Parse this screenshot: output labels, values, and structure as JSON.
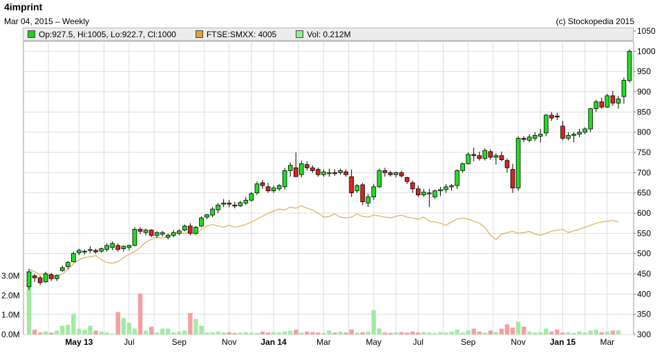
{
  "header": {
    "title": "4imprint",
    "subtitle": "Mar 04, 2015 – Weekly",
    "copyright": "(c) Stockopedia 2015"
  },
  "legend": [
    {
      "label": "Op:927.5, Hi:1005, Lo:922.7, Cl:1000",
      "color": "#22cc22"
    },
    {
      "label": "FTSE:SMXX: 4005",
      "color": "#e0a040"
    },
    {
      "label": "Vol: 0.212M",
      "color": "#90ee90"
    }
  ],
  "chart_data": {
    "type": "candlestick",
    "colors": {
      "up": "#22dd22",
      "down": "#dd2222",
      "index_line": "#e5b060",
      "vol_up": "#a4eaa4",
      "vol_down": "#f4a0a0",
      "grid": "#dddddd"
    },
    "price_axis": {
      "min": 300,
      "max": 1050,
      "ticks": [
        300,
        350,
        400,
        450,
        500,
        550,
        600,
        650,
        700,
        750,
        800,
        850,
        900,
        950,
        1000,
        1050
      ]
    },
    "volume_axis": {
      "min": 0,
      "max": 3.0,
      "ticks": [
        {
          "v": 0,
          "label": "0.0M"
        },
        {
          "v": 1,
          "label": "1.0M"
        },
        {
          "v": 2,
          "label": "2.0M"
        },
        {
          "v": 3,
          "label": "3.0M"
        }
      ]
    },
    "x_ticks": [
      {
        "i": 9,
        "label": "May 13",
        "bold": true
      },
      {
        "i": 18,
        "label": "Jul",
        "bold": false
      },
      {
        "i": 27,
        "label": "Sep",
        "bold": false
      },
      {
        "i": 36,
        "label": "Nov",
        "bold": false
      },
      {
        "i": 44,
        "label": "Jan 14",
        "bold": true
      },
      {
        "i": 53,
        "label": "Mar",
        "bold": false
      },
      {
        "i": 62,
        "label": "May",
        "bold": false
      },
      {
        "i": 70,
        "label": "Jul",
        "bold": false
      },
      {
        "i": 79,
        "label": "Sep",
        "bold": false
      },
      {
        "i": 88,
        "label": "Nov",
        "bold": false
      },
      {
        "i": 96,
        "label": "Jan 15",
        "bold": true
      },
      {
        "i": 104,
        "label": "Mar",
        "bold": false
      }
    ],
    "ohlc": [
      [
        418,
        462,
        410,
        455
      ],
      [
        445,
        450,
        430,
        440
      ],
      [
        440,
        445,
        422,
        428
      ],
      [
        430,
        455,
        428,
        450
      ],
      [
        448,
        452,
        432,
        438
      ],
      [
        438,
        448,
        432,
        446
      ],
      [
        458,
        470,
        455,
        465
      ],
      [
        468,
        482,
        462,
        478
      ],
      [
        480,
        505,
        478,
        500
      ],
      [
        502,
        512,
        496,
        508
      ],
      [
        505,
        510,
        498,
        506
      ],
      [
        508,
        518,
        502,
        510
      ],
      [
        508,
        512,
        500,
        504
      ],
      [
        506,
        515,
        502,
        512
      ],
      [
        510,
        525,
        505,
        520
      ],
      [
        515,
        530,
        508,
        525
      ],
      [
        520,
        525,
        505,
        510
      ],
      [
        512,
        520,
        505,
        518
      ],
      [
        515,
        522,
        508,
        520
      ],
      [
        520,
        565,
        518,
        560
      ],
      [
        560,
        565,
        548,
        555
      ],
      [
        552,
        562,
        545,
        558
      ],
      [
        558,
        560,
        540,
        545
      ],
      [
        545,
        555,
        538,
        552
      ],
      [
        548,
        556,
        542,
        552
      ],
      [
        540,
        550,
        535,
        545
      ],
      [
        545,
        558,
        540,
        552
      ],
      [
        550,
        560,
        545,
        556
      ],
      [
        558,
        572,
        555,
        568
      ],
      [
        568,
        575,
        545,
        550
      ],
      [
        550,
        568,
        548,
        565
      ],
      [
        568,
        592,
        565,
        588
      ],
      [
        590,
        598,
        585,
        596
      ],
      [
        595,
        615,
        590,
        610
      ],
      [
        608,
        625,
        600,
        620
      ],
      [
        622,
        635,
        615,
        625
      ],
      [
        625,
        632,
        615,
        622
      ],
      [
        620,
        628,
        612,
        618
      ],
      [
        618,
        630,
        615,
        626
      ],
      [
        625,
        640,
        620,
        632
      ],
      [
        632,
        652,
        628,
        648
      ],
      [
        650,
        678,
        645,
        672
      ],
      [
        675,
        682,
        660,
        668
      ],
      [
        665,
        675,
        650,
        655
      ],
      [
        655,
        668,
        650,
        662
      ],
      [
        660,
        672,
        655,
        668
      ],
      [
        665,
        712,
        658,
        705
      ],
      [
        705,
        725,
        690,
        718
      ],
      [
        712,
        750,
        705,
        690
      ],
      [
        695,
        730,
        688,
        722
      ],
      [
        720,
        728,
        705,
        712
      ],
      [
        712,
        718,
        700,
        705
      ],
      [
        708,
        712,
        690,
        695
      ],
      [
        695,
        708,
        690,
        702
      ],
      [
        700,
        710,
        690,
        700
      ],
      [
        700,
        708,
        692,
        698
      ],
      [
        700,
        710,
        695,
        705
      ],
      [
        702,
        708,
        690,
        695
      ],
      [
        690,
        708,
        640,
        650
      ],
      [
        655,
        672,
        650,
        668
      ],
      [
        670,
        675,
        620,
        628
      ],
      [
        625,
        648,
        615,
        640
      ],
      [
        640,
        672,
        632,
        665
      ],
      [
        665,
        710,
        662,
        705
      ],
      [
        705,
        712,
        690,
        700
      ],
      [
        700,
        705,
        690,
        695
      ],
      [
        695,
        702,
        688,
        700
      ],
      [
        700,
        705,
        688,
        692
      ],
      [
        688,
        690,
        672,
        678
      ],
      [
        675,
        680,
        650,
        660
      ],
      [
        660,
        668,
        640,
        645
      ],
      [
        645,
        660,
        640,
        652
      ],
      [
        650,
        660,
        615,
        650
      ],
      [
        640,
        658,
        635,
        655
      ],
      [
        655,
        665,
        642,
        658
      ],
      [
        658,
        672,
        650,
        665
      ],
      [
        665,
        672,
        655,
        668
      ],
      [
        668,
        708,
        660,
        705
      ],
      [
        705,
        725,
        700,
        722
      ],
      [
        722,
        750,
        720,
        745
      ],
      [
        745,
        762,
        728,
        742
      ],
      [
        742,
        752,
        730,
        735
      ],
      [
        735,
        760,
        730,
        755
      ],
      [
        752,
        758,
        732,
        738
      ],
      [
        738,
        748,
        720,
        742
      ],
      [
        742,
        752,
        728,
        732
      ],
      [
        730,
        735,
        700,
        712
      ],
      [
        708,
        722,
        650,
        662
      ],
      [
        662,
        790,
        655,
        785
      ],
      [
        785,
        790,
        775,
        782
      ],
      [
        780,
        795,
        775,
        788
      ],
      [
        785,
        800,
        778,
        792
      ],
      [
        790,
        808,
        775,
        795
      ],
      [
        798,
        845,
        790,
        842
      ],
      [
        842,
        850,
        828,
        835
      ],
      [
        840,
        848,
        830,
        838
      ],
      [
        815,
        828,
        780,
        785
      ],
      [
        785,
        800,
        780,
        792
      ],
      [
        792,
        800,
        775,
        795
      ],
      [
        795,
        808,
        788,
        800
      ],
      [
        800,
        812,
        795,
        808
      ],
      [
        808,
        860,
        800,
        858
      ],
      [
        858,
        880,
        850,
        875
      ],
      [
        875,
        885,
        858,
        862
      ],
      [
        862,
        895,
        860,
        890
      ],
      [
        890,
        902,
        865,
        872
      ],
      [
        872,
        890,
        858,
        882
      ],
      [
        888,
        935,
        870,
        928
      ],
      [
        927.5,
        1005,
        922.7,
        1000
      ]
    ],
    "volume": [
      3.5,
      0.25,
      0.1,
      0.15,
      0.1,
      0.2,
      0.45,
      0.5,
      1.05,
      0.3,
      0.25,
      0.45,
      0.2,
      0.15,
      0.1,
      0.05,
      1.15,
      0.85,
      0.6,
      0.3,
      2.1,
      0.2,
      0.4,
      0.1,
      0.3,
      0.3,
      0.1,
      0.15,
      0.2,
      1.1,
      0.8,
      0.45,
      0.1,
      0.1,
      0.15,
      0.1,
      0.12,
      0.08,
      0.1,
      0.12,
      0.1,
      0.08,
      0.15,
      0.1,
      0.12,
      0.1,
      0.15,
      0.2,
      0.25,
      0.1,
      0.15,
      0.12,
      0.1,
      0.08,
      0.2,
      0.1,
      0.15,
      0.1,
      0.25,
      0.1,
      0.12,
      0.15,
      1.25,
      0.3,
      0.1,
      0.08,
      0.1,
      0.12,
      0.1,
      0.15,
      0.1,
      0.12,
      0.1,
      0.08,
      0.12,
      0.1,
      0.15,
      0.25,
      0.1,
      0.2,
      0.3,
      0.15,
      0.1,
      0.2,
      0.12,
      0.3,
      0.52,
      0.35,
      0.65,
      0.4,
      0.15,
      0.1,
      0.12,
      0.3,
      0.15,
      0.25,
      0.1,
      0.12,
      0.08,
      0.15,
      0.1,
      0.2,
      0.25,
      0.12,
      0.15,
      0.2,
      0.212
    ],
    "index_line": [
      462,
      455,
      448,
      452,
      440,
      445,
      450,
      460,
      475,
      485,
      490,
      492,
      495,
      485,
      478,
      476,
      480,
      490,
      498,
      505,
      515,
      528,
      535,
      540,
      538,
      545,
      548,
      552,
      550,
      555,
      545,
      560,
      568,
      572,
      568,
      565,
      570,
      565,
      568,
      572,
      578,
      585,
      592,
      600,
      605,
      610,
      608,
      615,
      612,
      618,
      612,
      608,
      600,
      590,
      592,
      598,
      590,
      588,
      590,
      598,
      592,
      590,
      595,
      593,
      590,
      588,
      592,
      595,
      590,
      588,
      585,
      590,
      580,
      578,
      575,
      570,
      578,
      585,
      588,
      585,
      580,
      575,
      565,
      545,
      535,
      548,
      552,
      555,
      550,
      552,
      555,
      548,
      545,
      550,
      555,
      558,
      560,
      552,
      556,
      560,
      565,
      570,
      575,
      578,
      580,
      582,
      578
    ]
  }
}
